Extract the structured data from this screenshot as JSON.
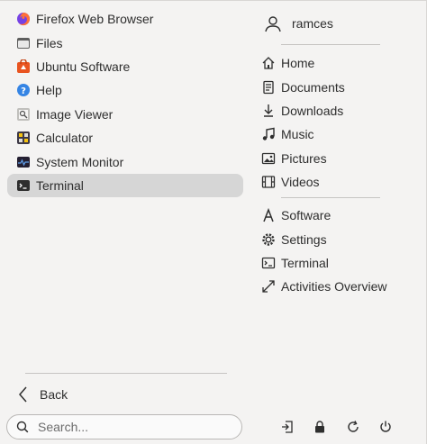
{
  "apps": [
    {
      "label": "Firefox Web Browser",
      "icon": "firefox-icon"
    },
    {
      "label": "Files",
      "icon": "folder-icon"
    },
    {
      "label": "Ubuntu Software",
      "icon": "software-bag-icon"
    },
    {
      "label": "Help",
      "icon": "help-icon"
    },
    {
      "label": "Image Viewer",
      "icon": "image-viewer-icon"
    },
    {
      "label": "Calculator",
      "icon": "calculator-icon"
    },
    {
      "label": "System Monitor",
      "icon": "system-monitor-icon"
    },
    {
      "label": "Terminal",
      "icon": "terminal-icon",
      "selected": true
    }
  ],
  "back_label": "Back",
  "search": {
    "placeholder": "Search..."
  },
  "user": {
    "name": "ramces"
  },
  "places": [
    {
      "label": "Home",
      "icon": "home-icon"
    },
    {
      "label": "Documents",
      "icon": "document-icon"
    },
    {
      "label": "Downloads",
      "icon": "download-icon"
    },
    {
      "label": "Music",
      "icon": "music-icon"
    },
    {
      "label": "Pictures",
      "icon": "picture-icon"
    },
    {
      "label": "Videos",
      "icon": "video-icon"
    }
  ],
  "system": [
    {
      "label": "Software",
      "icon": "software-icon"
    },
    {
      "label": "Settings",
      "icon": "settings-icon"
    },
    {
      "label": "Terminal",
      "icon": "terminal-icon"
    },
    {
      "label": "Activities Overview",
      "icon": "activities-icon"
    }
  ],
  "actions": [
    {
      "icon": "logout-icon"
    },
    {
      "icon": "lock-icon"
    },
    {
      "icon": "restart-icon"
    },
    {
      "icon": "power-icon"
    }
  ],
  "colors": {
    "background": "#f4f3f2",
    "selection": "#d6d6d6",
    "ubuntu_orange": "#e95420"
  }
}
